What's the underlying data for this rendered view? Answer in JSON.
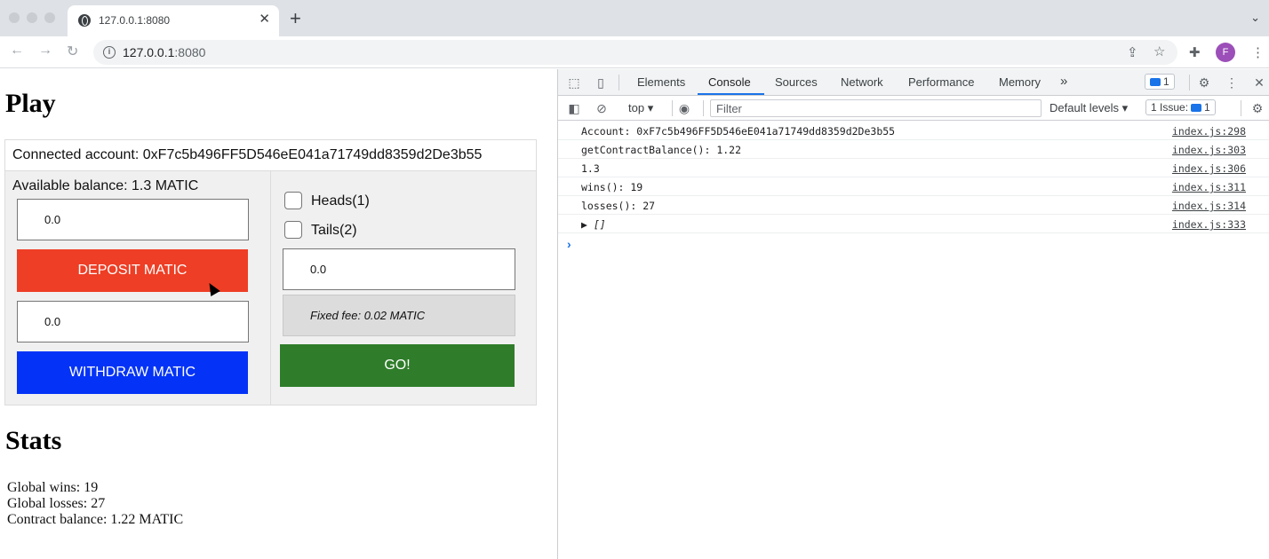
{
  "browser": {
    "tab_title": "127.0.0.1:8080",
    "tab_close": "✕",
    "new_tab": "+",
    "url_host": "127.0.0.1",
    "url_port": ":8080",
    "profile_initial": "F"
  },
  "page": {
    "play_heading": "Play",
    "connected_account": "Connected account: 0xF7c5b496FF5D546eE041a71749dd8359d2De3b55",
    "available_balance": "Available balance: 1.3 MATIC",
    "deposit_input": "0.0",
    "deposit_button": "DEPOSIT MATIC",
    "withdraw_input": "0.0",
    "withdraw_button": "WITHDRAW MATIC",
    "heads_label": "Heads(1)",
    "tails_label": "Tails(2)",
    "bet_input": "0.0",
    "fixed_fee": "Fixed fee: 0.02 MATIC",
    "go_button": "GO!",
    "stats_heading": "Stats",
    "global_wins": "Global wins: 19",
    "global_losses": "Global losses: 27",
    "contract_balance": "Contract balance: 1.22 MATIC",
    "colors": {
      "deposit": "#ee3e25",
      "withdraw": "#0433f7",
      "go": "#2f7d2a"
    }
  },
  "devtools": {
    "tabs": [
      "Elements",
      "Console",
      "Sources",
      "Network",
      "Performance",
      "Memory"
    ],
    "active_tab": "Console",
    "more_tabs": "»",
    "messages_badge": "1",
    "context": "top",
    "filter_placeholder": "Filter",
    "levels": "Default levels",
    "issues": "1 Issue:",
    "issues_count": "1",
    "logs": [
      {
        "text": "Account: 0xF7c5b496FF5D546eE041a71749dd8359d2De3b55",
        "src": "index.js:298"
      },
      {
        "text": "getContractBalance(): 1.22",
        "src": "index.js:303"
      },
      {
        "text": "1.3",
        "src": "index.js:306"
      },
      {
        "text": "wins(): 19",
        "src": "index.js:311"
      },
      {
        "text": "losses(): 27",
        "src": "index.js:314"
      },
      {
        "text": "▶ []",
        "src": "index.js:333"
      }
    ],
    "prompt": "›"
  }
}
